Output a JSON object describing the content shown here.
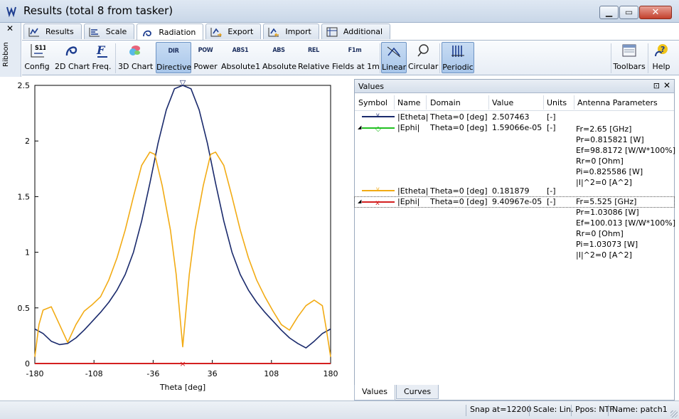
{
  "window": {
    "title": "Results (total 8 from tasker)",
    "buttons": {
      "minimize": "▁",
      "maximize": "▭",
      "close": "✕"
    }
  },
  "ribbon": {
    "label": "Ribbon",
    "close": "✕"
  },
  "tabs": [
    {
      "label": "Results",
      "icon": "results-icon"
    },
    {
      "label": "Scale",
      "icon": "scale-icon"
    },
    {
      "label": "Radiation",
      "icon": "radiation-icon",
      "active": true
    },
    {
      "label": "Export",
      "icon": "export-icon"
    },
    {
      "label": "Import",
      "icon": "import-icon"
    },
    {
      "label": "Additional",
      "icon": "additional-icon"
    }
  ],
  "toolbar": {
    "config": "Config",
    "config_icon_text": "S11",
    "chart2d": "2D Chart",
    "freq": "Freq.",
    "chart3d": "3D Chart",
    "directive": "Directive",
    "directive_icon_text": "DIR",
    "power": "Power",
    "power_icon_text": "POW",
    "absolute1": "Absolute1",
    "absolute1_icon_text": "ABS1",
    "absolute": "Absolute",
    "absolute_icon_text": "ABS",
    "relative": "Relative",
    "relative_icon_text": "REL",
    "fields1m": "Fields at 1m",
    "fields1m_icon_text": "F1m",
    "linear": "Linear",
    "circular": "Circular",
    "periodic": "Periodic",
    "toolbars": "Toolbars",
    "help": "Help"
  },
  "chart_data": {
    "type": "line",
    "xlabel": "Theta [deg]",
    "ylabel": "",
    "xlim": [
      -180,
      180
    ],
    "ylim": [
      0,
      2.5
    ],
    "xticks": [
      "-180",
      "-108",
      "-36",
      "36",
      "108",
      "180"
    ],
    "yticks": [
      "0",
      "0.5",
      "1",
      "1.5",
      "2",
      "2.5"
    ],
    "grid": false,
    "series": [
      {
        "name": "|Etheta|",
        "color": "#1a2a6c",
        "x": [
          -180,
          -170,
          -160,
          -150,
          -140,
          -130,
          -120,
          -110,
          -100,
          -90,
          -80,
          -70,
          -60,
          -50,
          -40,
          -30,
          -20,
          -10,
          0,
          10,
          20,
          30,
          40,
          50,
          60,
          70,
          80,
          90,
          100,
          110,
          120,
          130,
          140,
          150,
          160,
          170,
          180
        ],
        "y": [
          0.31,
          0.27,
          0.2,
          0.17,
          0.18,
          0.23,
          0.3,
          0.38,
          0.46,
          0.55,
          0.66,
          0.8,
          1.0,
          1.28,
          1.62,
          1.98,
          2.28,
          2.47,
          2.5,
          2.47,
          2.28,
          1.98,
          1.62,
          1.28,
          1.0,
          0.8,
          0.66,
          0.55,
          0.46,
          0.38,
          0.3,
          0.23,
          0.18,
          0.14,
          0.2,
          0.27,
          0.31
        ]
      },
      {
        "name": "|Ephi|",
        "color": "#22c022",
        "x": [
          -180,
          180
        ],
        "y": [
          0.0,
          0.0
        ]
      },
      {
        "name": "|Etheta|",
        "color": "#f2ab14",
        "x": [
          -180,
          -175,
          -170,
          -160,
          -150,
          -140,
          -130,
          -120,
          -110,
          -100,
          -90,
          -80,
          -70,
          -60,
          -50,
          -40,
          -34,
          -25,
          -15,
          -8,
          0,
          8,
          15,
          25,
          34,
          40,
          50,
          60,
          70,
          80,
          90,
          100,
          110,
          120,
          130,
          140,
          150,
          160,
          170,
          175,
          180
        ],
        "y": [
          0.06,
          0.35,
          0.48,
          0.51,
          0.35,
          0.19,
          0.35,
          0.47,
          0.53,
          0.6,
          0.75,
          0.95,
          1.2,
          1.5,
          1.78,
          1.9,
          1.88,
          1.6,
          1.2,
          0.8,
          0.15,
          0.8,
          1.2,
          1.6,
          1.88,
          1.9,
          1.78,
          1.5,
          1.2,
          0.95,
          0.75,
          0.6,
          0.47,
          0.35,
          0.3,
          0.42,
          0.52,
          0.57,
          0.52,
          0.3,
          0.06
        ]
      },
      {
        "name": "|Ephi|",
        "color": "#d42020",
        "x": [
          -180,
          180
        ],
        "y": [
          0.0,
          0.0
        ]
      }
    ],
    "markers": [
      {
        "series": 0,
        "symbol": "▽",
        "x": 0,
        "y": 2.5
      },
      {
        "series": 3,
        "symbol": "×",
        "x": 0,
        "y": 0.0
      }
    ]
  },
  "values_panel": {
    "title": "Values",
    "pin": "⊡",
    "close": "✕",
    "columns": [
      "Symbol",
      "Name",
      "Domain",
      "Value",
      "Units",
      "Antenna Parameters"
    ],
    "rows": [
      {
        "name": "|Etheta|",
        "domain": "Theta=0 [deg]",
        "value": "2.507463",
        "units": "[-]",
        "color": "#1a2a6c",
        "marker": "v"
      },
      {
        "name": "|Ephi|",
        "domain": "Theta=0 [deg]",
        "value": "1.59066e-05",
        "units": "[-]",
        "color": "#22c022",
        "marker": "◇"
      },
      {
        "name": "|Etheta|",
        "domain": "Theta=0 [deg]",
        "value": "0.181879",
        "units": "[-]",
        "color": "#f2ab14",
        "marker": "v"
      },
      {
        "name": "|Ephi|",
        "domain": "Theta=0 [deg]",
        "value": "9.40967e-05",
        "units": "[-]",
        "color": "#d42020",
        "marker": "x"
      }
    ],
    "params_group1": [
      "Fr=2.65 [GHz]",
      "Pr=0.815821 [W]",
      "Ef=98.8172 [W/W*100%]",
      "Rr=0 [Ohm]",
      "Pi=0.825586 [W]",
      "|I|^2=0 [A^2]"
    ],
    "params_group2": [
      "Fr=5.525 [GHz]",
      "Pr=1.03086 [W]",
      "Ef=100.013 [W/W*100%]",
      "Rr=0 [Ohm]",
      "Pi=1.03073 [W]",
      "|I|^2=0 [A^2]"
    ],
    "tabs": [
      "Values",
      "Curves"
    ]
  },
  "status": {
    "snap": "Snap at=12200",
    "scale": "Scale: Lin.",
    "ppos": "Ppos: NTF",
    "name": "Name: patch1"
  }
}
